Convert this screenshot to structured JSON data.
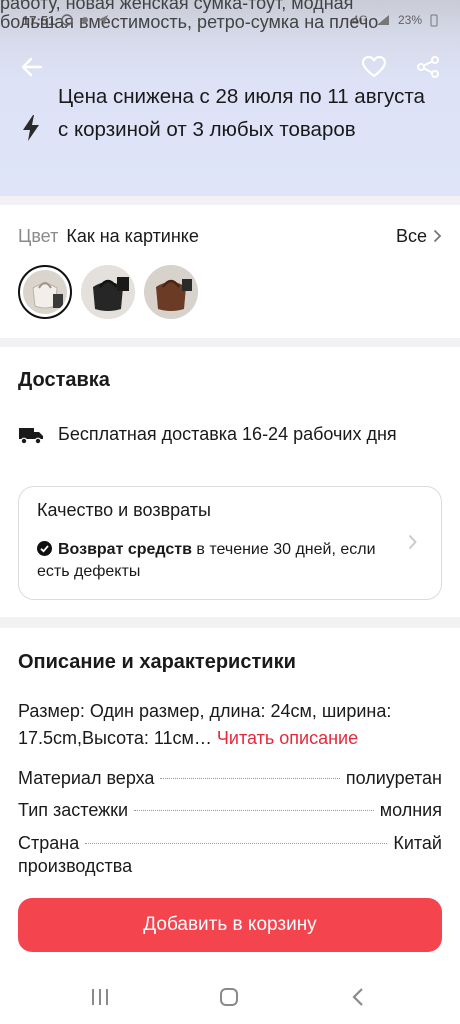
{
  "product_title": {
    "line1": "работу, новая женская сумка-тоут, модная",
    "line2": "большая вместимость, ретро-сумка на плечо"
  },
  "status_bar": {
    "time": "17:51",
    "network": "4G",
    "battery": "23%"
  },
  "icons": {
    "back": "arrow-left-icon",
    "favorite": "heart-icon",
    "share": "share-icon",
    "promo": "lightning-bolt-icon",
    "delivery": "truck-icon",
    "quality": "check-circle-icon"
  },
  "promo": {
    "text": "Цена снижена с 28 июля по 11 августа с корзиной от 3 любых товаров"
  },
  "color": {
    "label": "Цвет",
    "value": "Как на картинке",
    "all_label": "Все",
    "swatches": [
      {
        "name": "white",
        "color": "#e9e6e1",
        "selected": true
      },
      {
        "name": "black",
        "color": "#2a2a2a",
        "selected": false
      },
      {
        "name": "brown",
        "color": "#6b3b25",
        "selected": false
      }
    ]
  },
  "delivery": {
    "title": "Доставка",
    "shipping_text": "Бесплатная доставка 16-24 рабочих дня",
    "quality": {
      "title": "Качество и возвраты",
      "bold": "Возврат средств",
      "rest": " в течение 30 дней, если есть дефекты"
    }
  },
  "description": {
    "title": "Описание и характеристики",
    "size_text": "Размер: Один размер, длина: 24см, ширина: 17.5cm,Высота: 11см…",
    "read_more": "Читать описание",
    "specs": [
      {
        "key": "Материал верха",
        "value": "полиуретан"
      },
      {
        "key": "Тип застежки",
        "value": "молния"
      },
      {
        "key": "Страна",
        "value": "Китай",
        "key_cont": "производства"
      }
    ]
  },
  "cart_button": {
    "label": "Добавить в корзину"
  },
  "colors": {
    "accent": "#f4454f",
    "link": "#e5283a",
    "promo_bg": "#dfe4f8"
  }
}
